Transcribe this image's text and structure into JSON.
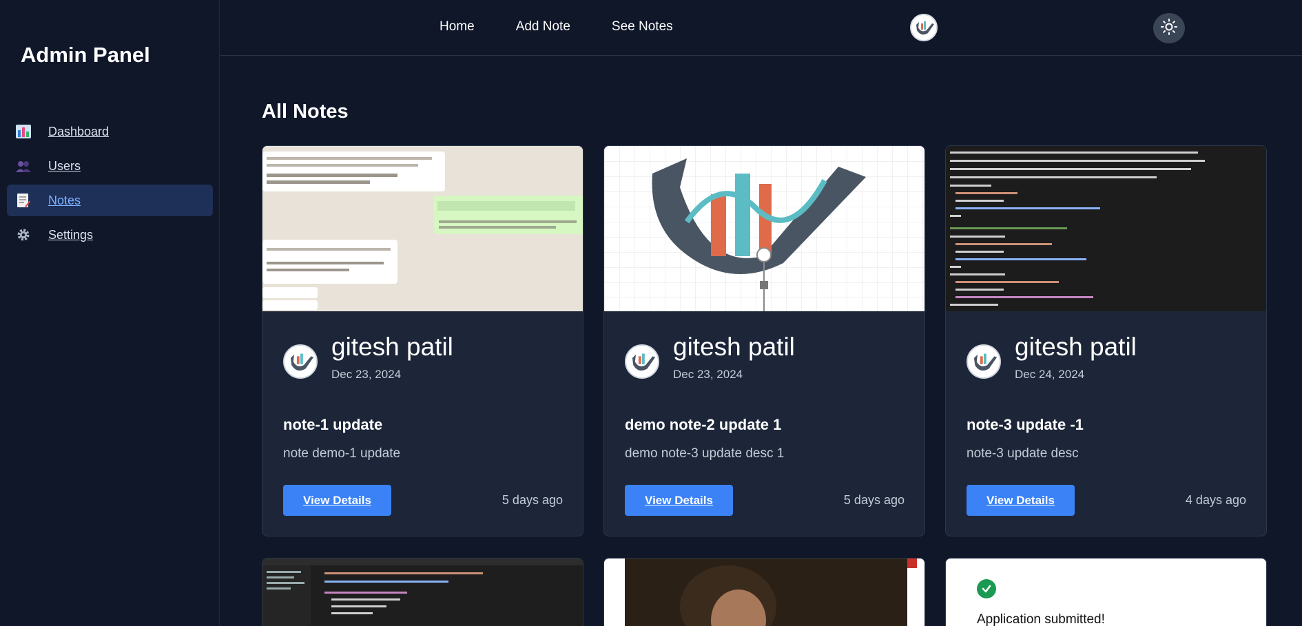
{
  "sidebar": {
    "brand": "Admin Panel",
    "items": [
      {
        "label": "Dashboard",
        "icon": "bar-chart-icon"
      },
      {
        "label": "Users",
        "icon": "users-icon"
      },
      {
        "label": "Notes",
        "icon": "note-icon"
      },
      {
        "label": "Settings",
        "icon": "gear-icon"
      }
    ],
    "active": "Notes"
  },
  "topnav": {
    "items": [
      "Home",
      "Add Note",
      "See Notes"
    ]
  },
  "main": {
    "title": "All Notes",
    "cards": [
      {
        "author": "gitesh patil",
        "date": "Dec 23, 2024",
        "title": "note-1 update",
        "desc": "note demo-1 update",
        "button": "View Details",
        "ago": "5 days ago"
      },
      {
        "author": "gitesh patil",
        "date": "Dec 23, 2024",
        "title": "demo note-2 update 1",
        "desc": "demo note-3 update desc 1",
        "button": "View Details",
        "ago": "5 days ago"
      },
      {
        "author": "gitesh patil",
        "date": "Dec 24, 2024",
        "title": "note-3 update -1",
        "desc": "note-3 update desc",
        "button": "View Details",
        "ago": "4 days ago"
      }
    ],
    "partial_card_text": "Application submitted!"
  },
  "colors": {
    "background": "#0f1729",
    "card": "#1d2638",
    "accent": "#3b82f6",
    "active_nav": "#1e3058"
  }
}
